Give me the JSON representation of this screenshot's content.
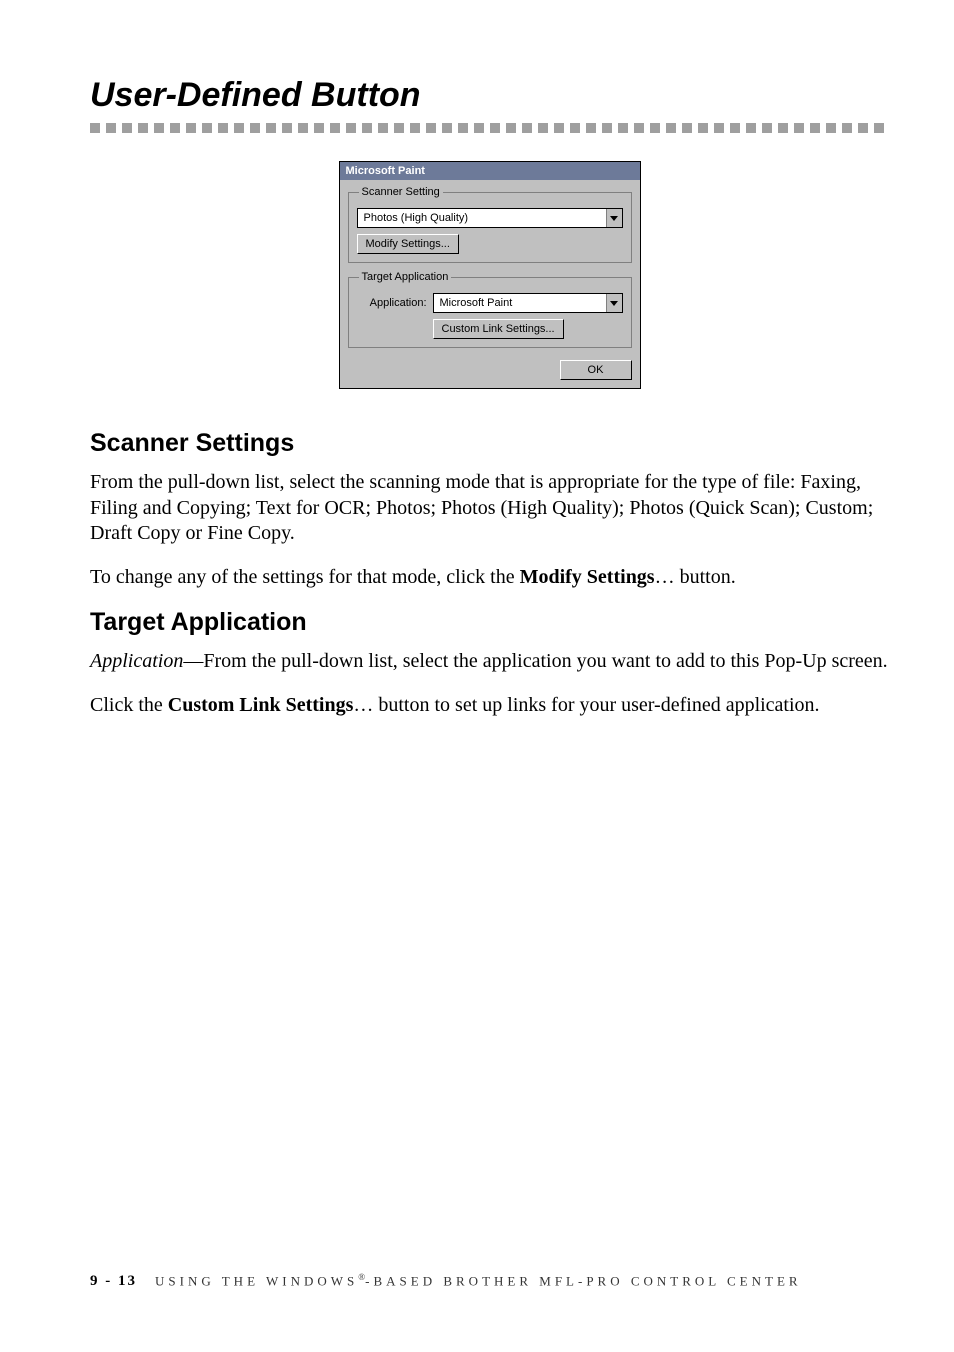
{
  "heading": "User-Defined Button",
  "dialog": {
    "title": "Microsoft Paint",
    "scanner_setting_legend": "Scanner Setting",
    "scanner_setting_value": "Photos (High Quality)",
    "modify_settings_label": "Modify Settings...",
    "target_application_legend": "Target Application",
    "application_label": "Application:",
    "application_value": "Microsoft Paint",
    "custom_link_settings_label": "Custom Link Settings...",
    "ok_label": "OK"
  },
  "scanner_settings": {
    "heading": "Scanner Settings",
    "para1": "From the pull-down list, select the scanning mode that is appropriate for the type of file:  Faxing, Filing and Copying; Text for OCR; Photos; Photos (High Quality); Photos (Quick Scan); Custom; Draft Copy or Fine Copy.",
    "para2_pre": "To change any of the settings for that mode, click the ",
    "para2_bold": "Modify Settings",
    "para2_post": "… button."
  },
  "target_application": {
    "heading": "Target Application",
    "para1_italic": "Application",
    "para1_rest": "—From the pull-down list, select the application you want to add to this Pop-Up screen.",
    "para2_pre": "Click the ",
    "para2_bold": "Custom Link Settings",
    "para2_post": "… button to set up links for your user-defined application."
  },
  "footer": {
    "page": "9 - 13",
    "chapter_pre": "USING THE WINDOWS",
    "chapter_sup": "®",
    "chapter_post": "-BASED BROTHER MFL-PRO CONTROL CENTER"
  }
}
